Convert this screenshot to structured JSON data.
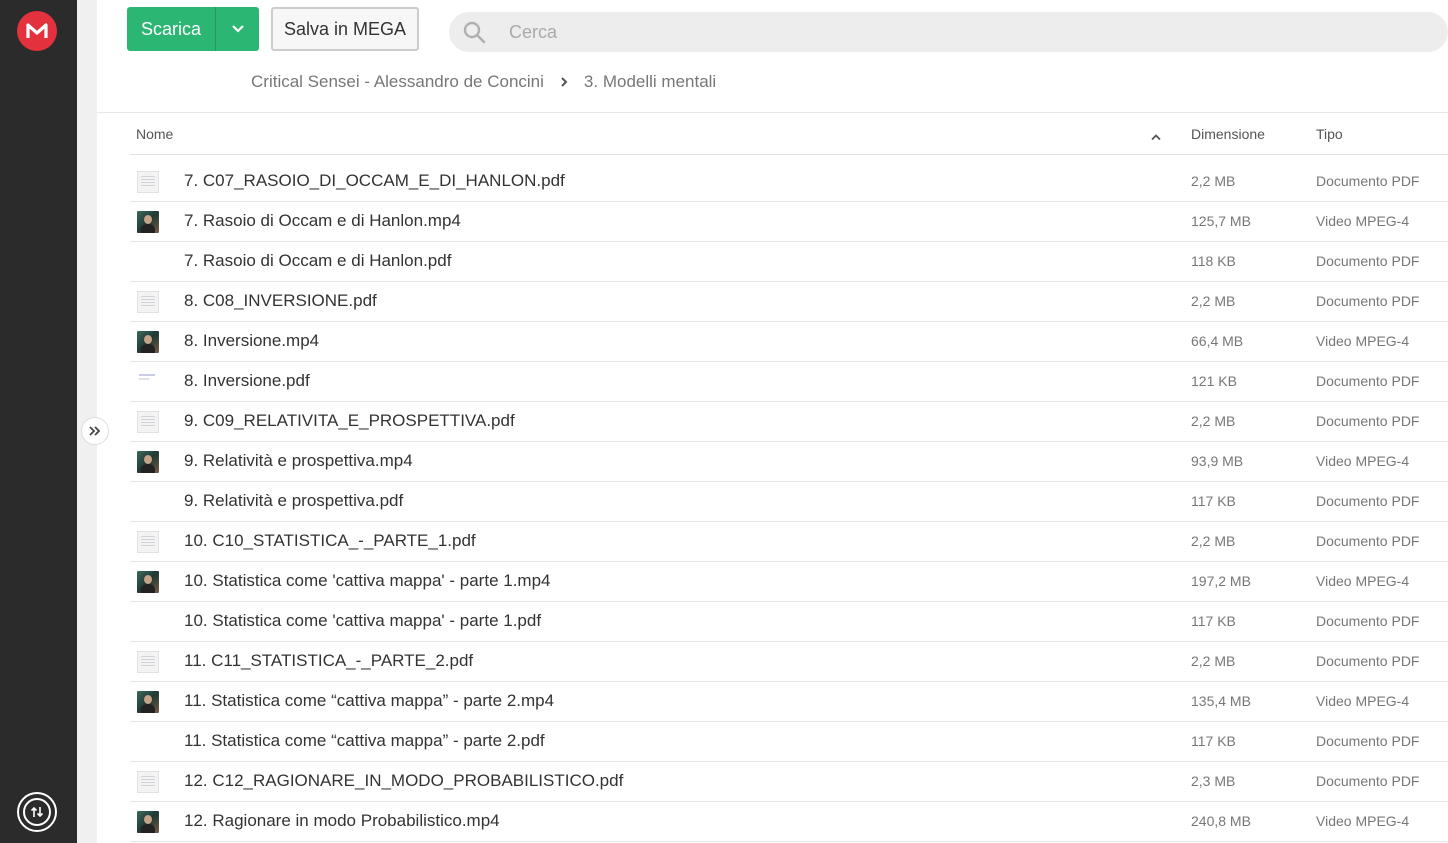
{
  "toolbar": {
    "download_label": "Scarica",
    "save_label": "Salva in MEGA"
  },
  "search": {
    "placeholder": "Cerca"
  },
  "breadcrumb": {
    "parent": "Critical Sensei - Alessandro de Concini",
    "current": "3. Modelli mentali"
  },
  "table": {
    "headers": {
      "name": "Nome",
      "size": "Dimensione",
      "type": "Tipo"
    },
    "rows": [
      {
        "name": "7. C07_RASOIO_DI_OCCAM_E_DI_HANLON.pdf",
        "size": "2,2 MB",
        "type": "Documento PDF",
        "thumb": "doc"
      },
      {
        "name": "7. Rasoio di Occam e di Hanlon.mp4",
        "size": "125,7 MB",
        "type": "Video MPEG-4",
        "thumb": "vid"
      },
      {
        "name": "7. Rasoio di Occam e di Hanlon.pdf",
        "size": "118 KB",
        "type": "Documento PDF",
        "thumb": "none"
      },
      {
        "name": "8. C08_INVERSIONE.pdf",
        "size": "2,2 MB",
        "type": "Documento PDF",
        "thumb": "doc"
      },
      {
        "name": "8. Inversione.mp4",
        "size": "66,4 MB",
        "type": "Video MPEG-4",
        "thumb": "vid"
      },
      {
        "name": "8. Inversione.pdf",
        "size": "121 KB",
        "type": "Documento PDF",
        "thumb": "faint"
      },
      {
        "name": "9. C09_RELATIVITA_E_PROSPETTIVA.pdf",
        "size": "2,2 MB",
        "type": "Documento PDF",
        "thumb": "doc"
      },
      {
        "name": "9. Relatività e prospettiva.mp4",
        "size": "93,9 MB",
        "type": "Video MPEG-4",
        "thumb": "vid"
      },
      {
        "name": "9. Relatività e prospettiva.pdf",
        "size": "117 KB",
        "type": "Documento PDF",
        "thumb": "none"
      },
      {
        "name": "10. C10_STATISTICA_-_PARTE_1.pdf",
        "size": "2,2 MB",
        "type": "Documento PDF",
        "thumb": "doc"
      },
      {
        "name": "10. Statistica come 'cattiva mappa' - parte 1.mp4",
        "size": "197,2 MB",
        "type": "Video MPEG-4",
        "thumb": "vid"
      },
      {
        "name": "10. Statistica come 'cattiva mappa' - parte 1.pdf",
        "size": "117 KB",
        "type": "Documento PDF",
        "thumb": "none"
      },
      {
        "name": "11. C11_STATISTICA_-_PARTE_2.pdf",
        "size": "2,2 MB",
        "type": "Documento PDF",
        "thumb": "doc"
      },
      {
        "name": "11. Statistica come “cattiva mappa” - parte 2.mp4",
        "size": "135,4 MB",
        "type": "Video MPEG-4",
        "thumb": "vid"
      },
      {
        "name": "11. Statistica come “cattiva mappa” - parte 2.pdf",
        "size": "117 KB",
        "type": "Documento PDF",
        "thumb": "none"
      },
      {
        "name": "12. C12_RAGIONARE_IN_MODO_PROBABILISTICO.pdf",
        "size": "2,3 MB",
        "type": "Documento PDF",
        "thumb": "doc"
      },
      {
        "name": "12. Ragionare in modo Probabilistico.mp4",
        "size": "240,8 MB",
        "type": "Video MPEG-4",
        "thumb": "vid"
      }
    ]
  },
  "icons": {
    "logo": "mega-logo-icon",
    "transfer": "transfer-manager-icon",
    "expand": "expand-sidebar-icon",
    "search": "search-icon",
    "dropdown": "chevron-down-icon",
    "sort": "sort-ascending-icon"
  },
  "colors": {
    "brand": "#e3313d",
    "download": "#2bb673",
    "rail": "#2b2b2b"
  }
}
